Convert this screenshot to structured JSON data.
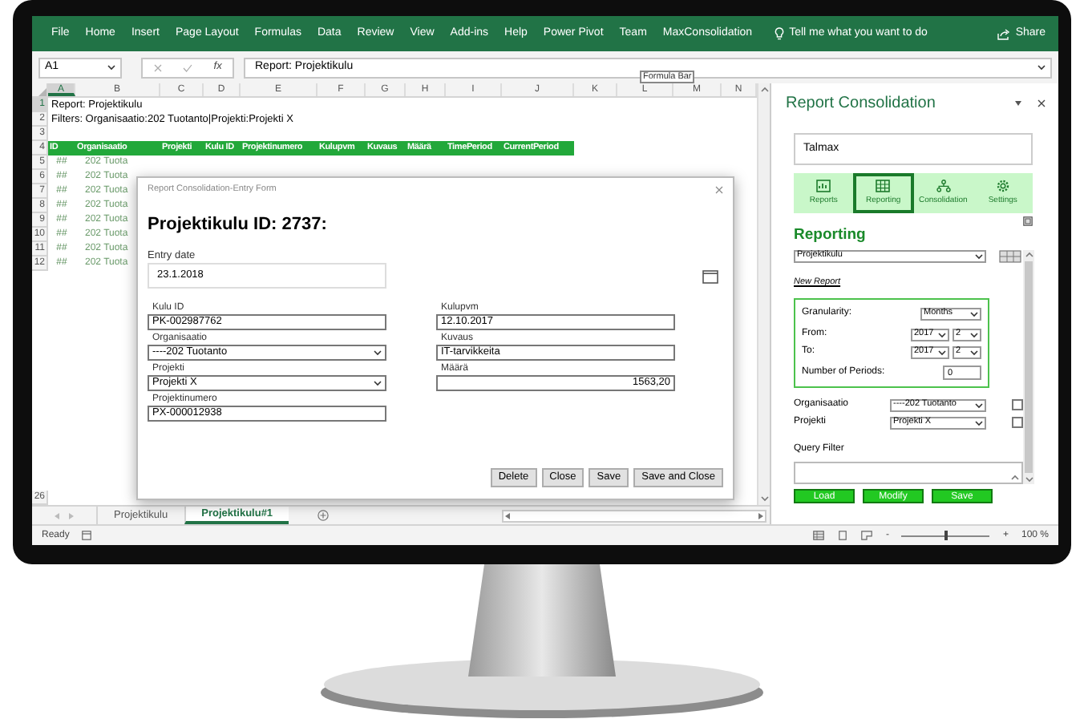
{
  "ribbon": {
    "tabs": [
      "File",
      "Home",
      "Insert",
      "Page Layout",
      "Formulas",
      "Data",
      "Review",
      "View",
      "Add-ins",
      "Help",
      "Power Pivot",
      "Team",
      "MaxConsolidation"
    ],
    "tell_me": "Tell me what you want to do",
    "share": "Share"
  },
  "formula_bar": {
    "name_box": "A1",
    "function_label": "fx",
    "formula": "Report: Projektikulu",
    "tooltip": "Formula Bar"
  },
  "sheet": {
    "columns": [
      {
        "label": "A",
        "selected": true
      },
      {
        "label": "B",
        "selected": false
      },
      {
        "label": "C",
        "selected": false
      },
      {
        "label": "D",
        "selected": false
      },
      {
        "label": "E",
        "selected": false
      },
      {
        "label": "F",
        "selected": false
      },
      {
        "label": "G",
        "selected": false
      },
      {
        "label": "H",
        "selected": false
      },
      {
        "label": "I",
        "selected": false
      },
      {
        "label": "J",
        "selected": false
      },
      {
        "label": "K",
        "selected": false
      },
      {
        "label": "L",
        "selected": false
      },
      {
        "label": "M",
        "selected": false
      },
      {
        "label": "N",
        "selected": false
      }
    ],
    "rows": [
      {
        "number": "1",
        "kind": "text",
        "selected": true,
        "text": "Report: Projektikulu"
      },
      {
        "number": "2",
        "kind": "text",
        "selected": false,
        "text": "Filters: Organisaatio:202 Tuotanto|Projekti:Projekti X"
      },
      {
        "number": "3",
        "kind": "blank",
        "selected": false
      },
      {
        "number": "4",
        "kind": "header",
        "selected": false,
        "cells": [
          "ID",
          "Organisaatio",
          "Projekti",
          "Kulu ID",
          "Projektinumero",
          "Kulupvm",
          "Kuvaus",
          "Määrä",
          "TimePeriod",
          "CurrentPeriod"
        ]
      },
      {
        "number": "5",
        "kind": "data",
        "selected": false,
        "cells": [
          "##",
          "202 Tuota"
        ]
      },
      {
        "number": "6",
        "kind": "data",
        "selected": false,
        "cells": [
          "##",
          "202 Tuota"
        ]
      },
      {
        "number": "7",
        "kind": "data",
        "selected": false,
        "cells": [
          "##",
          "202 Tuota"
        ]
      },
      {
        "number": "8",
        "kind": "data",
        "selected": false,
        "cells": [
          "##",
          "202 Tuota"
        ]
      },
      {
        "number": "9",
        "kind": "data",
        "selected": false,
        "cells": [
          "##",
          "202 Tuota"
        ]
      },
      {
        "number": "10",
        "kind": "data",
        "selected": false,
        "cells": [
          "##",
          "202 Tuota"
        ]
      },
      {
        "number": "11",
        "kind": "data",
        "selected": false,
        "cells": [
          "##",
          "202 Tuota"
        ]
      },
      {
        "number": "12",
        "kind": "data",
        "selected": false,
        "cells": [
          "##",
          "202 Tuota"
        ]
      },
      {
        "number": "26",
        "kind": "blank",
        "selected": false
      }
    ]
  },
  "sheet_tabs": [
    {
      "label": "Projektikulu",
      "selected": false
    },
    {
      "label": "Projektikulu#1",
      "selected": true
    }
  ],
  "dialog": {
    "title": "Report Consolidation-Entry Form",
    "heading": "Projektikulu ID: 2737:",
    "entry_date": {
      "label": "Entry date",
      "value": "23.1.2018"
    },
    "left_fields": [
      {
        "kind": "text",
        "label": "Kulu ID",
        "value": "PK-002987762"
      },
      {
        "kind": "select",
        "label": "Organisaatio",
        "value": "----202 Tuotanto"
      },
      {
        "kind": "select",
        "label": "Projekti",
        "value": "Projekti X"
      },
      {
        "kind": "text",
        "label": "Projektinumero",
        "value": "PX-000012938"
      }
    ],
    "right_fields": [
      {
        "kind": "text",
        "label": "Kulupvm",
        "value": "12.10.2017"
      },
      {
        "kind": "text",
        "label": "Kuvaus",
        "value": "IT-tarvikkeita"
      },
      {
        "kind": "number",
        "label": "Määrä",
        "value": "1563,20"
      }
    ],
    "buttons": [
      "Delete",
      "Close",
      "Save",
      "Save and Close"
    ]
  },
  "task_pane": {
    "title": "Report Consolidation",
    "company": "Talmax",
    "nav": [
      {
        "label": "Reports",
        "selected": false
      },
      {
        "label": "Reporting",
        "selected": true
      },
      {
        "label": "Consolidation",
        "selected": false
      },
      {
        "label": "Settings",
        "selected": false
      }
    ],
    "heading": "Reporting",
    "report": "Projektikulu",
    "new_report": "New Report",
    "granularity": {
      "label": "Granularity:",
      "value": "Months"
    },
    "from": {
      "label": "From:",
      "year": "2017",
      "month": "2"
    },
    "to": {
      "label": "To:",
      "year": "2017",
      "month": "2"
    },
    "periods": {
      "label": "Number of Periods:",
      "value": "0"
    },
    "filters": [
      {
        "label": "Organisaatio",
        "value": "----202 Tuotanto",
        "checked": false
      },
      {
        "label": "Projekti",
        "value": "Projekti X",
        "checked": false
      }
    ],
    "query_filter": "Query Filter",
    "buttons": [
      "Load",
      "Modify",
      "Save"
    ]
  },
  "status_bar": {
    "status": "Ready",
    "zoom_out": "-",
    "zoom_in": "+",
    "zoom": "100 %",
    "level": 0.5
  }
}
